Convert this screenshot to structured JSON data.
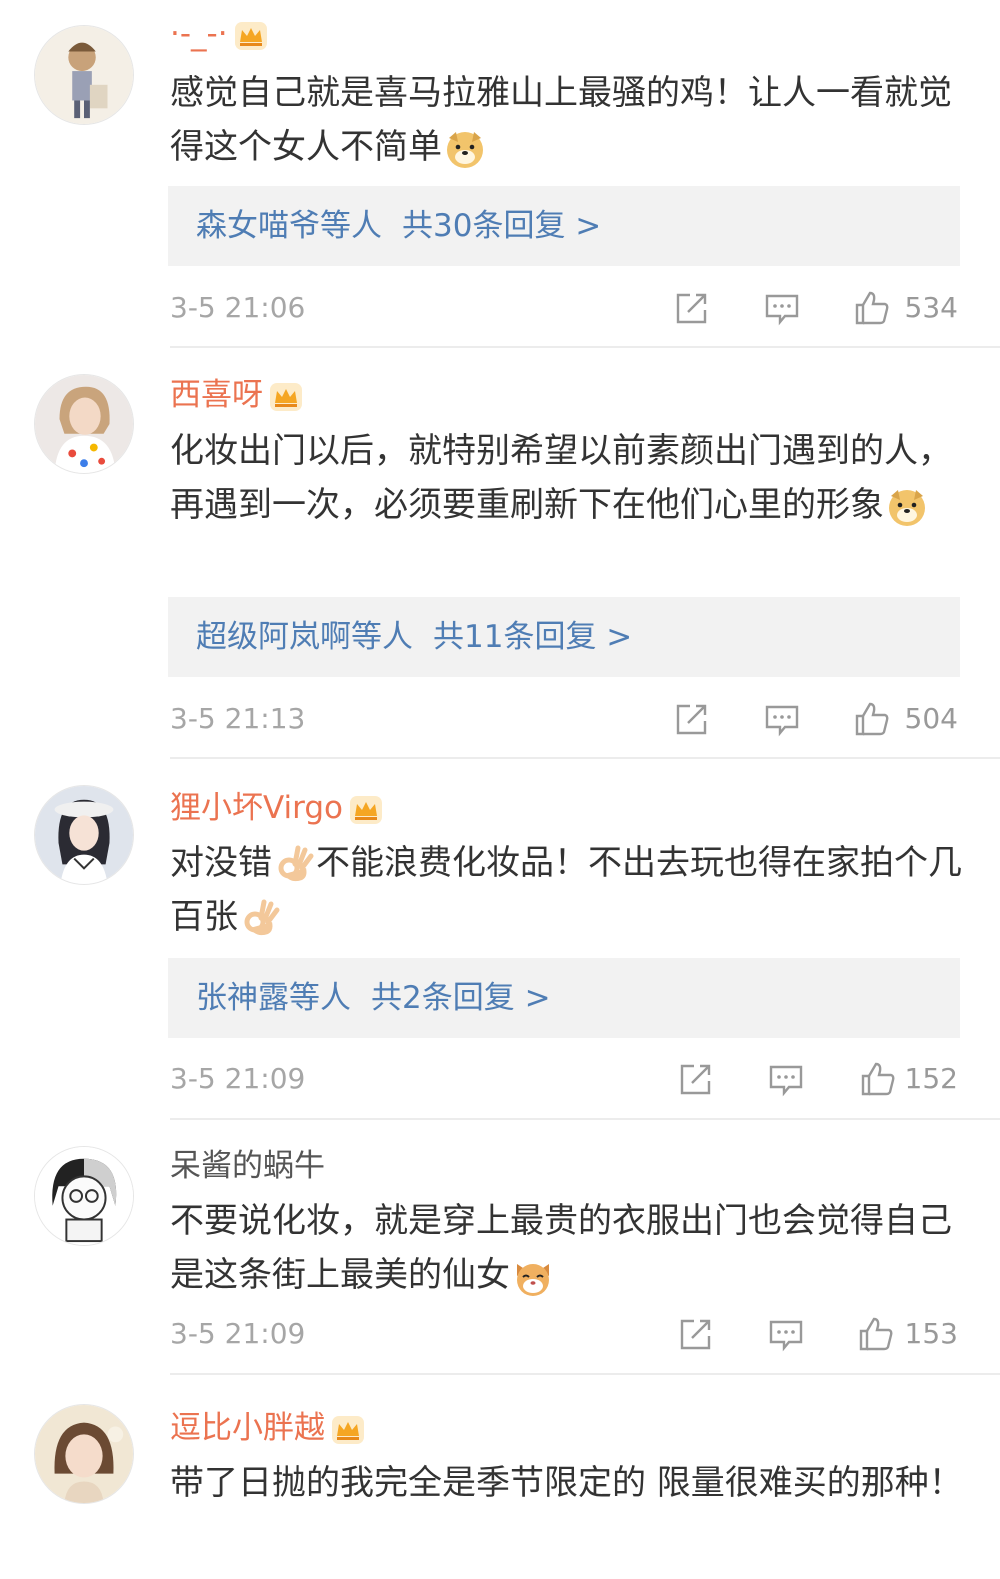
{
  "comments": [
    {
      "username": "·-_-·",
      "text": "感觉自己就是喜马拉雅山上最骚的鸡！让人一看就觉得这个女人不简单",
      "emoji": "doge-emoji",
      "reply_users": "森女喵爷等人",
      "reply_count": "共30条回复 >",
      "time": "3-5 21:06",
      "likes": "534"
    },
    {
      "username": "西喜呀",
      "text": "化妆出门以后，就特别希望以前素颜出门遇到的人，再遇到一次，必须要重刷新下在他们心里的形象",
      "emoji": "doge-emoji",
      "reply_users": "超级阿岚啊等人",
      "reply_count": "共11条回复 >",
      "time": "3-5 21:13",
      "likes": "504"
    },
    {
      "username": "狸小坏Virgo",
      "text_part1": "对没错",
      "text_part2": "不能浪费化妆品！不出去玩也得在家拍个几百张",
      "emoji": "ok-hand-emoji",
      "reply_users": "张神露等人",
      "reply_count": "共2条回复 >",
      "time": "3-5 21:09",
      "likes": "152"
    },
    {
      "username": "呆酱的蜗牛",
      "text": "不要说化妆，就是穿上最贵的衣服出门也会觉得自己是这条街上最美的仙女",
      "emoji": "cat-face-emoji",
      "time": "3-5 21:09",
      "likes": "153"
    },
    {
      "username": "逗比小胖越",
      "text": "带了日抛的我完全是季节限定的 限量很难买的那种！"
    }
  ],
  "colors": {
    "vip_name": "#eb7350",
    "link": "#4f7db4",
    "meta": "#a6a6a6",
    "reply_bg": "#f2f2f2",
    "crown": "#f5a623"
  },
  "icons": {
    "badge": "crown-icon",
    "share": "share-icon",
    "comment": "comment-icon",
    "like": "thumbs-up-icon"
  }
}
